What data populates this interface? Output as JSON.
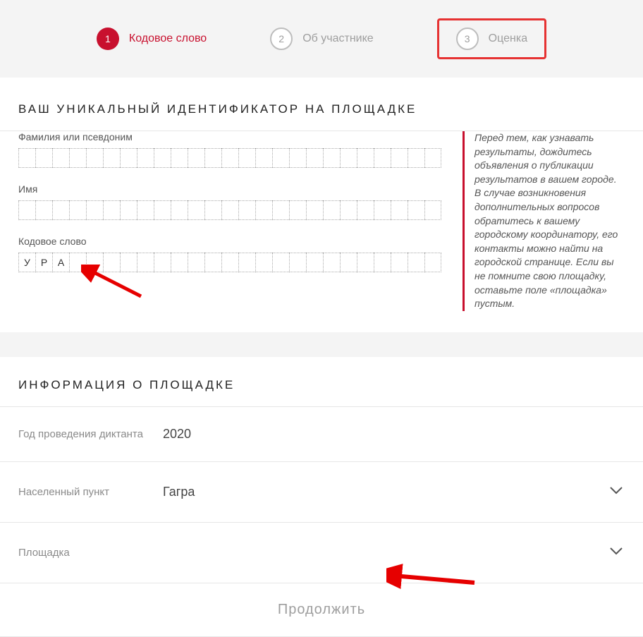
{
  "stepper": {
    "items": [
      {
        "num": "1",
        "label": "Кодовое слово"
      },
      {
        "num": "2",
        "label": "Об участнике"
      },
      {
        "num": "3",
        "label": "Оценка"
      }
    ]
  },
  "identifier": {
    "section_title": "ВАШ УНИКАЛЬНЫЙ ИДЕНТИФИКАТОР НА ПЛОЩАДКЕ",
    "surname_label": "Фамилия или псевдоним",
    "surname_value": "",
    "name_label": "Имя",
    "name_value": "",
    "codeword_label": "Кодовое слово",
    "codeword_value": "УРА",
    "cell_count": 25,
    "hint": "Перед тем, как узнавать результаты, дождитесь объявления о публикации результатов в вашем городе. В случае возникновения дополнительных вопросов обратитесь к вашему городскому координатору, его контакты можно найти на городской странице. Если вы не помните свою площадку, оставьте поле «площадка» пустым."
  },
  "venue": {
    "section_title": "ИНФОРМАЦИЯ О ПЛОЩАДКЕ",
    "year_label": "Год проведения диктанта",
    "year_value": "2020",
    "city_label": "Населенный пункт",
    "city_value": "Гагра",
    "site_label": "Площадка",
    "site_value": ""
  },
  "continue_label": "Продолжить"
}
